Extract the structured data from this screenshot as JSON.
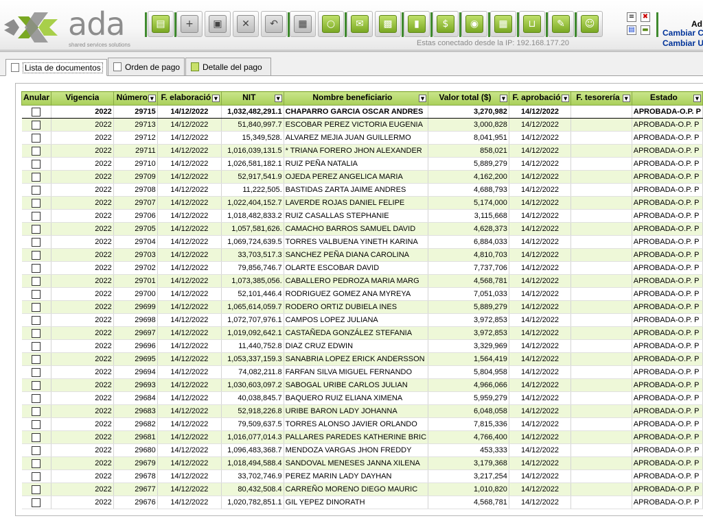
{
  "header": {
    "logo_text": "ada",
    "logo_tagline": "shared services solutions",
    "ip_text": "Estas conectado desde la IP: 192.168.177.20",
    "user_name": "Ad",
    "link_1": "Cambiar Cl",
    "link_2": "Cambiar U",
    "brand_color": "#7aa823"
  },
  "toolbar": [
    {
      "name": "open-folder-icon",
      "glyph": "▤",
      "style": "green"
    },
    {
      "name": "new-document-icon",
      "glyph": "+",
      "style": "grey2"
    },
    {
      "name": "save-icon",
      "glyph": "▣",
      "style": "grey2"
    },
    {
      "name": "delete-icon",
      "glyph": "✕",
      "style": "grey2"
    },
    {
      "name": "undo-icon",
      "glyph": "↶",
      "style": "grey2"
    },
    {
      "name": "print-icon",
      "glyph": "▦",
      "style": "grey2"
    },
    {
      "name": "search-icon",
      "glyph": "○",
      "style": "green"
    },
    {
      "name": "export-excel-icon",
      "glyph": "✉",
      "style": "green"
    },
    {
      "name": "open-box-icon",
      "glyph": "▩",
      "style": "green"
    },
    {
      "name": "lock-icon",
      "glyph": "▮",
      "style": "green"
    },
    {
      "name": "money-bag-icon",
      "glyph": "$",
      "style": "green"
    },
    {
      "name": "camera-icon",
      "glyph": "◉",
      "style": "green"
    },
    {
      "name": "grid-icon",
      "glyph": "▦",
      "style": "green"
    },
    {
      "name": "cart-icon",
      "glyph": "⊔",
      "style": "green"
    },
    {
      "name": "settings-icon",
      "glyph": "✎",
      "style": "green"
    },
    {
      "name": "users-icon",
      "glyph": "☺",
      "style": "green"
    }
  ],
  "tabs": [
    {
      "label": "Lista de documentos",
      "active": true
    },
    {
      "label": "Orden de pago",
      "active": false
    },
    {
      "label": "Detalle del pago",
      "active": false
    }
  ],
  "table": {
    "columns": [
      "Anular",
      "Vigencia",
      "Número",
      "F. elaboració",
      "NIT",
      "Nombre beneficiario",
      "Valor total ($)",
      "F. aprobació",
      "F. tesorería",
      "Estado"
    ],
    "rows": [
      [
        "2022",
        "29715",
        "14/12/2022",
        "1,032,482,291.1",
        "CHAPARRO GARCIA OSCAR ANDRES",
        "3,270,982",
        "14/12/2022",
        "",
        "APROBADA-O.P. P"
      ],
      [
        "2022",
        "29713",
        "14/12/2022",
        "51,840,997.7",
        "ESCOBAR PEREZ VICTORIA EUGENIA",
        "3,000,828",
        "14/12/2022",
        "",
        "APROBADA-O.P. P"
      ],
      [
        "2022",
        "29712",
        "14/12/2022",
        "15,349,528.",
        "ALVAREZ MEJIA JUAN GUILLERMO",
        "8,041,951",
        "14/12/2022",
        "",
        "APROBADA-O.P. P"
      ],
      [
        "2022",
        "29711",
        "14/12/2022",
        "1,016,039,131.5",
        "* TRIANA FORERO JHON ALEXANDER",
        "858,021",
        "14/12/2022",
        "",
        "APROBADA-O.P. P"
      ],
      [
        "2022",
        "29710",
        "14/12/2022",
        "1,026,581,182.1",
        "RUIZ PEÑA NATALIA",
        "5,889,279",
        "14/12/2022",
        "",
        "APROBADA-O.P. P"
      ],
      [
        "2022",
        "29709",
        "14/12/2022",
        "52,917,541.9",
        "OJEDA PEREZ ANGELICA MARIA",
        "4,162,200",
        "14/12/2022",
        "",
        "APROBADA-O.P. P"
      ],
      [
        "2022",
        "29708",
        "14/12/2022",
        "11,222,505.",
        "BASTIDAS ZARTA JAIME ANDRES",
        "4,688,793",
        "14/12/2022",
        "",
        "APROBADA-O.P. P"
      ],
      [
        "2022",
        "29707",
        "14/12/2022",
        "1,022,404,152.7",
        "LAVERDE ROJAS DANIEL FELIPE",
        "5,174,000",
        "14/12/2022",
        "",
        "APROBADA-O.P. P"
      ],
      [
        "2022",
        "29706",
        "14/12/2022",
        "1,018,482,833.2",
        "RUIZ CASALLAS STEPHANIE",
        "3,115,668",
        "14/12/2022",
        "",
        "APROBADA-O.P. P"
      ],
      [
        "2022",
        "29705",
        "14/12/2022",
        "1,057,581,626.",
        "CAMACHO BARROS SAMUEL DAVID",
        "4,628,373",
        "14/12/2022",
        "",
        "APROBADA-O.P. P"
      ],
      [
        "2022",
        "29704",
        "14/12/2022",
        "1,069,724,639.5",
        "TORRES VALBUENA YINETH KARINA",
        "6,884,033",
        "14/12/2022",
        "",
        "APROBADA-O.P. P"
      ],
      [
        "2022",
        "29703",
        "14/12/2022",
        "33,703,517.3",
        "SANCHEZ PEÑA DIANA CAROLINA",
        "4,810,703",
        "14/12/2022",
        "",
        "APROBADA-O.P. P"
      ],
      [
        "2022",
        "29702",
        "14/12/2022",
        "79,856,746.7",
        "OLARTE ESCOBAR DAVID",
        "7,737,706",
        "14/12/2022",
        "",
        "APROBADA-O.P. P"
      ],
      [
        "2022",
        "29701",
        "14/12/2022",
        "1,073,385,056.",
        "CABALLERO PEDROZA MARIA MARG",
        "4,568,781",
        "14/12/2022",
        "",
        "APROBADA-O.P. P"
      ],
      [
        "2022",
        "29700",
        "14/12/2022",
        "52,101,446.4",
        "RODRIGUEZ GOMEZ ANA MYREYA",
        "7,051,033",
        "14/12/2022",
        "",
        "APROBADA-O.P. P"
      ],
      [
        "2022",
        "29699",
        "14/12/2022",
        "1,065,614,059.7",
        "RODERO ORTIZ DUBIELA INES",
        "5,889,279",
        "14/12/2022",
        "",
        "APROBADA-O.P. P"
      ],
      [
        "2022",
        "29698",
        "14/12/2022",
        "1,072,707,976.1",
        "CAMPOS LOPEZ JULIANA",
        "3,972,853",
        "14/12/2022",
        "",
        "APROBADA-O.P. P"
      ],
      [
        "2022",
        "29697",
        "14/12/2022",
        "1,019,092,642.1",
        "CASTAÑEDA GONZÁLEZ STEFANIA",
        "3,972,853",
        "14/12/2022",
        "",
        "APROBADA-O.P. P"
      ],
      [
        "2022",
        "29696",
        "14/12/2022",
        "11,440,752.8",
        "DIAZ CRUZ EDWIN",
        "3,329,969",
        "14/12/2022",
        "",
        "APROBADA-O.P. P"
      ],
      [
        "2022",
        "29695",
        "14/12/2022",
        "1,053,337,159.3",
        "SANABRIA LOPEZ ERICK ANDERSSON",
        "1,564,419",
        "14/12/2022",
        "",
        "APROBADA-O.P. P"
      ],
      [
        "2022",
        "29694",
        "14/12/2022",
        "74,082,211.8",
        "FARFAN SILVA MIGUEL FERNANDO",
        "5,804,958",
        "14/12/2022",
        "",
        "APROBADA-O.P. P"
      ],
      [
        "2022",
        "29693",
        "14/12/2022",
        "1,030,603,097.2",
        "SABOGAL URIBE CARLOS JULIAN",
        "4,966,066",
        "14/12/2022",
        "",
        "APROBADA-O.P. P"
      ],
      [
        "2022",
        "29684",
        "14/12/2022",
        "40,038,845.7",
        "BAQUERO RUIZ ELIANA XIMENA",
        "5,959,279",
        "14/12/2022",
        "",
        "APROBADA-O.P. P"
      ],
      [
        "2022",
        "29683",
        "14/12/2022",
        "52,918,226.8",
        "URIBE BARON LADY JOHANNA",
        "6,048,058",
        "14/12/2022",
        "",
        "APROBADA-O.P. P"
      ],
      [
        "2022",
        "29682",
        "14/12/2022",
        "79,509,637.5",
        "TORRES ALONSO JAVIER ORLANDO",
        "7,815,336",
        "14/12/2022",
        "",
        "APROBADA-O.P. P"
      ],
      [
        "2022",
        "29681",
        "14/12/2022",
        "1,016,077,014.3",
        "PALLARES PAREDES KATHERINE BRIC",
        "4,766,400",
        "14/12/2022",
        "",
        "APROBADA-O.P. P"
      ],
      [
        "2022",
        "29680",
        "14/12/2022",
        "1,096,483,368.7",
        "MENDOZA VARGAS JHON FREDDY",
        "453,333",
        "14/12/2022",
        "",
        "APROBADA-O.P. P"
      ],
      [
        "2022",
        "29679",
        "14/12/2022",
        "1,018,494,588.4",
        "SANDOVAL MENESES JANNA XILENA",
        "3,179,368",
        "14/12/2022",
        "",
        "APROBADA-O.P. P"
      ],
      [
        "2022",
        "29678",
        "14/12/2022",
        "33,702,746.9",
        "PEREZ MARIN LADY DAYHAN",
        "3,217,254",
        "14/12/2022",
        "",
        "APROBADA-O.P. P"
      ],
      [
        "2022",
        "29677",
        "14/12/2022",
        "80,432,508.4",
        "CARREÑO MORENO DIEGO MAURIC",
        "1,010,820",
        "14/12/2022",
        "",
        "APROBADA-O.P. P"
      ],
      [
        "2022",
        "29676",
        "14/12/2022",
        "1,020,782,851.1",
        "GIL YEPEZ DINORATH",
        "4,568,781",
        "14/12/2022",
        "",
        "APROBADA-O.P. P"
      ]
    ]
  }
}
